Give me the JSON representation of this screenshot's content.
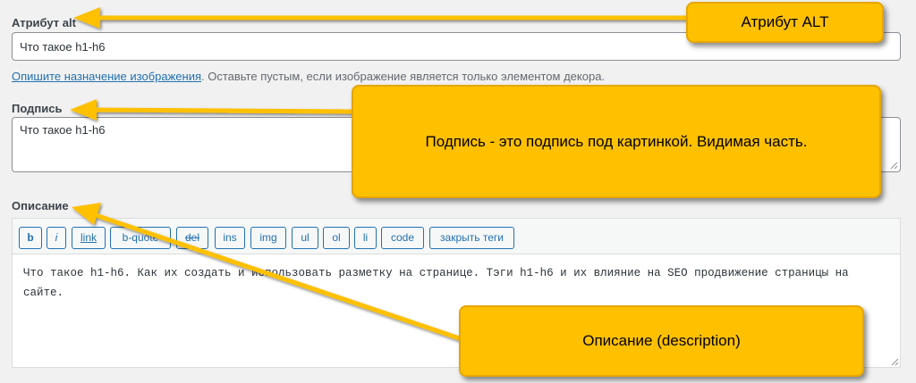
{
  "alt": {
    "label": "Атрибут alt",
    "value": "Что такое h1-h6",
    "help_link": "Опишите назначение изображения",
    "help_text": ". Оставьте пустым, если изображение является только элементом декора."
  },
  "caption": {
    "label": "Подпись",
    "value": "Что такое h1-h6"
  },
  "description": {
    "label": "Описание",
    "toolbar": [
      "b",
      "i",
      "link",
      "b-quote",
      "del",
      "ins",
      "img",
      "ul",
      "ol",
      "li",
      "code",
      "закрыть теги"
    ],
    "value": "Что такое h1-h6. Как их создать и использовать разметку на странице. Тэги h1-h6 и их влияние на SEO продвижение страницы на сайте."
  },
  "callouts": {
    "alt": "Атрибут ALT",
    "caption": "Подпись - это подпись под картинкой. Видимая часть.",
    "description": "Описание (description)"
  },
  "colors": {
    "callout_fill": "#ffc000",
    "link": "#2271b1",
    "arrow": "#ffc000"
  }
}
